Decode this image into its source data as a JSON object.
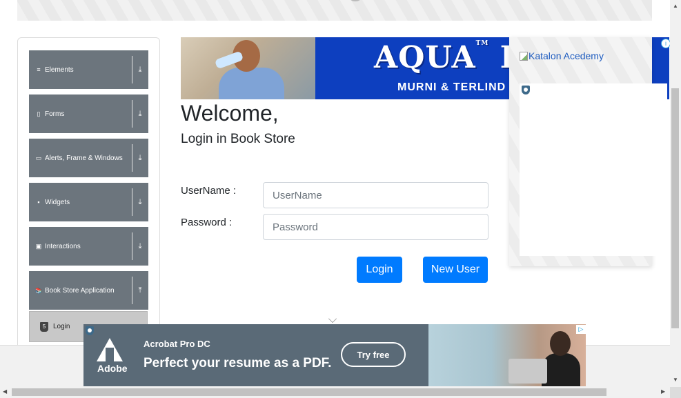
{
  "sidebar": {
    "groups": [
      {
        "label": "Elements",
        "icon": "list-icon",
        "glyph": "≡",
        "arrow": "⤓"
      },
      {
        "label": "Forms",
        "icon": "form-icon",
        "glyph": "▯",
        "arrow": "⤓"
      },
      {
        "label": "Alerts, Frame & Windows",
        "icon": "window-icon",
        "glyph": "▭",
        "arrow": "⤓"
      },
      {
        "label": "Widgets",
        "icon": "widgets-icon",
        "glyph": "▪",
        "arrow": "⤓"
      },
      {
        "label": "Interactions",
        "icon": "interactions-icon",
        "glyph": "▣",
        "arrow": "⤓"
      },
      {
        "label": "Book Store Application",
        "icon": "book-icon",
        "glyph": "📚",
        "arrow": "⤒"
      }
    ],
    "active_item": {
      "label": "Login",
      "glyph": "5"
    }
  },
  "ad_top": {
    "brand": "AQUA",
    "brand_suffix": "DU",
    "tm": "TM",
    "slogan": "MURNI & TERLIND",
    "info": "i"
  },
  "ad_right": {
    "link_text": "Katalon Acedemy"
  },
  "login": {
    "welcome": "Welcome,",
    "subtitle": "Login in Book Store",
    "username_label": "UserName :",
    "username_placeholder": "UserName",
    "username_value": "",
    "password_label": "Password :",
    "password_placeholder": "Password",
    "password_value": "",
    "login_button": "Login",
    "new_user_button": "New User"
  },
  "ad_bottom": {
    "logo_word": "Adobe",
    "product": "Acrobat Pro DC",
    "headline": "Perfect your resume as a PDF.",
    "cta": "Try free",
    "choice": "▷"
  },
  "scrollbars": {
    "up": "▲",
    "down": "▼",
    "left": "◀",
    "right": "▶"
  }
}
